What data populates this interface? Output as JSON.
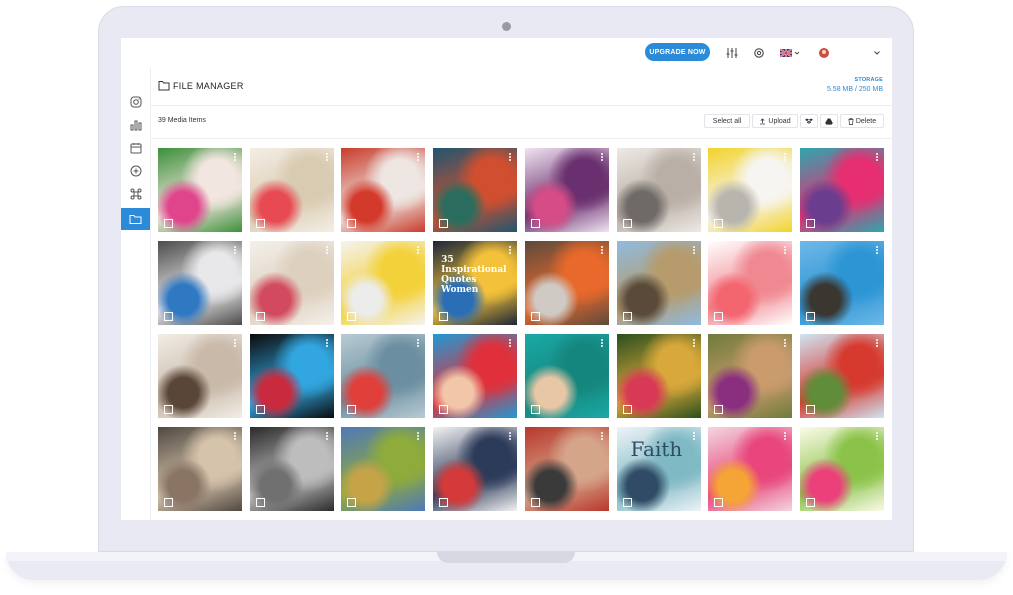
{
  "topbar": {
    "upgrade_label": "UPGRADE NOW",
    "icons": [
      "sliders-icon",
      "gear-icon",
      "uk-flag-icon",
      "avatar-icon",
      "chevron-down-icon"
    ]
  },
  "sidebar": {
    "items": [
      {
        "icon": "instagram-icon"
      },
      {
        "icon": "bar-chart-icon"
      },
      {
        "icon": "calendar-icon"
      },
      {
        "icon": "plus-circle-icon"
      },
      {
        "icon": "command-icon"
      },
      {
        "icon": "folder-icon",
        "active": true
      }
    ]
  },
  "page": {
    "title": "FILE MANAGER",
    "storage_label": "STORAGE",
    "storage_value": "5.58 MB / 250 MB"
  },
  "toolbar": {
    "count_label": "39 Media Items",
    "select_all": "Select all",
    "upload": "Upload",
    "delete": "Delete"
  },
  "tiles": [
    {
      "c1": "#3c8f3a",
      "c2": "#f2e6e0",
      "c3": "#e0458b"
    },
    {
      "c1": "#f4eee4",
      "c2": "#d9cbb2",
      "c3": "#e84a52"
    },
    {
      "c1": "#c83c2a",
      "c2": "#eee6e2",
      "c3": "#d33a2c"
    },
    {
      "c1": "#1f5670",
      "c2": "#d14f2f",
      "c3": "#2a6d5e"
    },
    {
      "c1": "#f0e4f2",
      "c2": "#6a2f6e",
      "c3": "#d64c86"
    },
    {
      "c1": "#ede9e4",
      "c2": "#b9afa6",
      "c3": "#6f6a67"
    },
    {
      "c1": "#f2d32b",
      "c2": "#f7f5f1",
      "c3": "#b8b5ae"
    },
    {
      "c1": "#2da7b0",
      "c2": "#e62e70",
      "c3": "#6a3d8e"
    },
    {
      "c1": "#4c4c4c",
      "c2": "#e8e8ea",
      "c3": "#2f78c2"
    },
    {
      "c1": "#f4f0ea",
      "c2": "#ddd0be",
      "c3": "#d24a5e"
    },
    {
      "c1": "#f5f3ee",
      "c2": "#f3d13a",
      "c3": "#ececea"
    },
    {
      "c1": "#1b2638",
      "c2": "#f4c23a",
      "c3": "#2a6eb6",
      "caption": "35 Inspirational Quotes Women"
    },
    {
      "c1": "#5d4a3d",
      "c2": "#e8692b",
      "c3": "#cfcac4"
    },
    {
      "c1": "#8fbbe0",
      "c2": "#b69b6c",
      "c3": "#5a4a39"
    },
    {
      "c1": "#ffffff",
      "c2": "#f08891",
      "c3": "#f3656f"
    },
    {
      "c1": "#6fb8e8",
      "c2": "#2c95d4",
      "c3": "#3a3630"
    },
    {
      "c1": "#f2ede6",
      "c2": "#c8b9a8",
      "c3": "#5a4638"
    },
    {
      "c1": "#0b0b0b",
      "c2": "#32a6e0",
      "c3": "#c92a3d"
    },
    {
      "c1": "#b9cbd4",
      "c2": "#6b8fa0",
      "c3": "#e03f3a"
    },
    {
      "c1": "#1f9ad4",
      "c2": "#e0303c",
      "c3": "#f2c6a8"
    },
    {
      "c1": "#1aa9a5",
      "c2": "#15867d",
      "c3": "#e8c7a6"
    },
    {
      "c1": "#2b4f1e",
      "c2": "#d8a83a",
      "c3": "#d83a55"
    },
    {
      "c1": "#6f7b3a",
      "c2": "#c99b6d",
      "c3": "#8a2f7f"
    },
    {
      "c1": "#cfe4f2",
      "c2": "#d63a2f",
      "c3": "#5f8d3a"
    },
    {
      "c1": "#504840",
      "c2": "#d5c3ab",
      "c3": "#8a7564"
    },
    {
      "c1": "#2b2b2b",
      "c2": "#bdbdbd",
      "c3": "#707070"
    },
    {
      "c1": "#4f78b8",
      "c2": "#8eab3c",
      "c3": "#c7a348"
    },
    {
      "c1": "#f2f2f2",
      "c2": "#2c3b5a",
      "c3": "#d43a3a"
    },
    {
      "c1": "#b8382c",
      "c2": "#d5a58a",
      "c3": "#3a3a3a"
    },
    {
      "c1": "#eef3f7",
      "c2": "#7fb9c4",
      "c3": "#2f4b66",
      "caption": "Faith"
    },
    {
      "c1": "#f3d6df",
      "c2": "#e8467c",
      "c3": "#f5a535"
    },
    {
      "c1": "#fbfbe8",
      "c2": "#8bc34a",
      "c3": "#ec407a"
    }
  ]
}
